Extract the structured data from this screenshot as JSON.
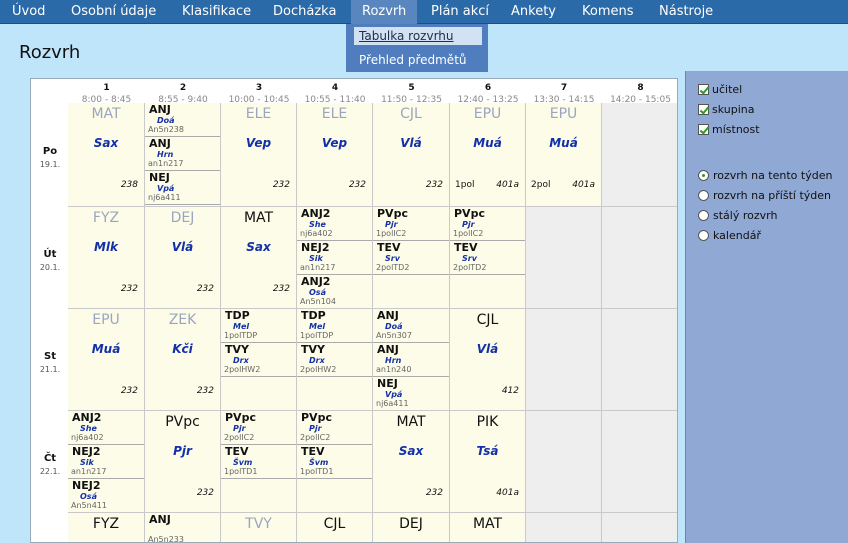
{
  "menu": [
    "Úvod",
    "Osobní údaje",
    "Klasifikace",
    "Docházka",
    "Rozvrh",
    "Plán akcí",
    "Ankety",
    "Komens",
    "Nástroje"
  ],
  "submenu": [
    "Tabulka rozvrhu",
    "Přehled předmětů"
  ],
  "title": "Rozvrh",
  "hours": [
    {
      "n": "1",
      "t": "8:00 - 8:45"
    },
    {
      "n": "2",
      "t": "8:55 - 9:40"
    },
    {
      "n": "3",
      "t": "10:00 - 10:45"
    },
    {
      "n": "4",
      "t": "10:55 - 11:40"
    },
    {
      "n": "5",
      "t": "11:50 - 12:35"
    },
    {
      "n": "6",
      "t": "12:40 - 13:25"
    },
    {
      "n": "7",
      "t": "13:30 - 14:15"
    },
    {
      "n": "8",
      "t": "14:20 - 15:05"
    }
  ],
  "days": [
    {
      "d": "Po",
      "dt": "19.1."
    },
    {
      "d": "Út",
      "dt": "20.1."
    },
    {
      "d": "St",
      "dt": "21.1."
    },
    {
      "d": "Čt",
      "dt": "22.1."
    },
    {
      "d": "",
      "dt": ""
    }
  ],
  "rows": [
    [
      {
        "s": "MAT",
        "t": "Sax",
        "r": "238"
      },
      {
        "parts": [
          {
            "s": "ANJ",
            "t": "Doá",
            "g": "An5n238"
          },
          {
            "s": "ANJ",
            "t": "Hrn",
            "g": "an1n217"
          },
          {
            "s": "NEJ",
            "t": "Vpá",
            "g": "nj6a411"
          }
        ]
      },
      {
        "s": "ELE",
        "t": "Vep",
        "r": "232"
      },
      {
        "s": "ELE",
        "t": "Vep",
        "r": "232"
      },
      {
        "s": "CJL",
        "t": "Vlá",
        "r": "232"
      },
      {
        "s": "EPU",
        "t": "Muá",
        "r": "401a",
        "l": "1pol"
      },
      {
        "s": "EPU",
        "t": "Muá",
        "r": "401a",
        "l": "2pol"
      },
      {
        "e": true
      }
    ],
    [
      {
        "s": "FYZ",
        "t": "Mlk",
        "r": "232"
      },
      {
        "s": "DEJ",
        "t": "Vlá",
        "r": "232"
      },
      {
        "s": "MAT",
        "t": "Sax",
        "r": "232"
      },
      {
        "parts": [
          {
            "s": "ANJ2",
            "t": "She",
            "g": "nj6a402"
          },
          {
            "s": "NEJ2",
            "t": "Sik",
            "g": "an1n217"
          },
          {
            "s": "ANJ2",
            "t": "Osá",
            "g": "An5n104"
          }
        ]
      },
      {
        "parts": [
          {
            "s": "PVpc",
            "t": "Pjr",
            "g": "1polIC2"
          },
          {
            "s": "TEV",
            "t": "Srv",
            "g": "2polTD2"
          }
        ]
      },
      {
        "parts": [
          {
            "s": "PVpc",
            "t": "Pjr",
            "g": "1polIC2"
          },
          {
            "s": "TEV",
            "t": "Srv",
            "g": "2polTD2"
          }
        ]
      },
      {
        "e": true
      },
      {
        "e": true
      }
    ],
    [
      {
        "s": "EPU",
        "t": "Muá",
        "r": "232"
      },
      {
        "s": "ZEK",
        "t": "Kči",
        "r": "232"
      },
      {
        "parts": [
          {
            "s": "TDP",
            "t": "Mel",
            "g": "1polTDP"
          },
          {
            "s": "TVY",
            "t": "Drx",
            "g": "2polHW2"
          }
        ]
      },
      {
        "parts": [
          {
            "s": "TDP",
            "t": "Mel",
            "g": "1polTDP"
          },
          {
            "s": "TVY",
            "t": "Drx",
            "g": "2polHW2"
          }
        ]
      },
      {
        "parts": [
          {
            "s": "ANJ",
            "t": "Doá",
            "g": "An5n307"
          },
          {
            "s": "ANJ",
            "t": "Hrn",
            "g": "an1n240"
          },
          {
            "s": "NEJ",
            "t": "Vpá",
            "g": "nj6a411"
          }
        ]
      },
      {
        "s": "CJL",
        "t": "Vlá",
        "r": "412"
      },
      {
        "e": true
      },
      {
        "e": true
      }
    ],
    [
      {
        "parts": [
          {
            "s": "ANJ2",
            "t": "She",
            "g": "nj6a402"
          },
          {
            "s": "NEJ2",
            "t": "Sik",
            "g": "an1n217"
          },
          {
            "s": "NEJ2",
            "t": "Osá",
            "g": "An5n411"
          }
        ]
      },
      {
        "s": "PVpc",
        "t": "Pjr",
        "r": "232"
      },
      {
        "parts": [
          {
            "s": "PVpc",
            "t": "Pjr",
            "g": "2polIC2"
          },
          {
            "s": "TEV",
            "t": "Švm",
            "g": "1polTD1"
          }
        ]
      },
      {
        "parts": [
          {
            "s": "PVpc",
            "t": "Pjr",
            "g": "2polIC2"
          },
          {
            "s": "TEV",
            "t": "Švm",
            "g": "1polTD1"
          }
        ]
      },
      {
        "s": "MAT",
        "t": "Sax",
        "r": "232"
      },
      {
        "s": "PIK",
        "t": "Tsá",
        "r": "401a"
      },
      {
        "e": true
      },
      {
        "e": true
      }
    ],
    [
      {
        "s": "FYZ"
      },
      {
        "parts": [
          {
            "s": "ANJ",
            "t": "",
            "g": "An5n233"
          }
        ]
      },
      {
        "s": "TVY",
        "grey": true
      },
      {
        "s": "CJL"
      },
      {
        "s": "DEJ"
      },
      {
        "s": "MAT"
      },
      {
        "e": true
      },
      {
        "e": true
      }
    ]
  ],
  "side": {
    "checks": [
      "učitel",
      "skupina",
      "místnost"
    ],
    "radios": [
      "rozvrh na tento týden",
      "rozvrh na příští týden",
      "stálý rozvrh",
      "kalendář"
    ],
    "radio_selected": 0
  }
}
